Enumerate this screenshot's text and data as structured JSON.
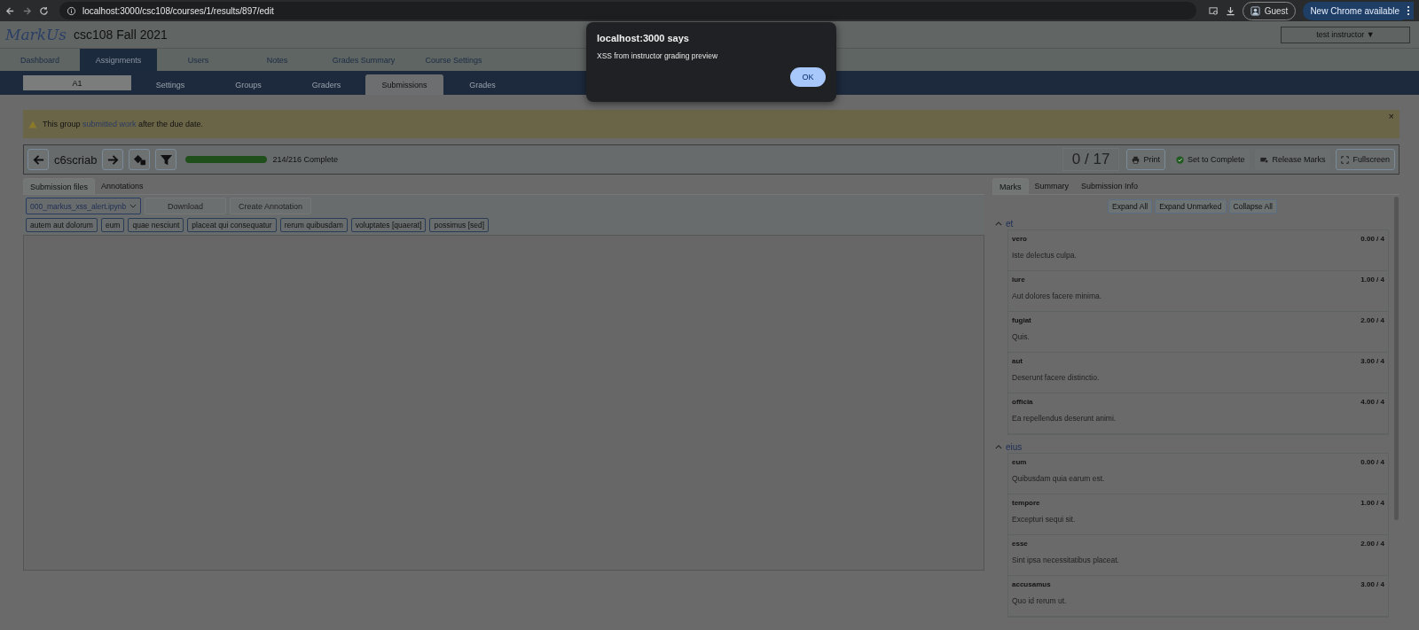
{
  "browser": {
    "url": "localhost:3000/csc108/courses/1/results/897/edit",
    "profile": "Guest",
    "update": "New Chrome available"
  },
  "dialog": {
    "title": "localhost:3000 says",
    "message": "XSS from instructor grading preview",
    "ok": "OK"
  },
  "header": {
    "logo": "MarkUs",
    "course": "csc108 Fall 2021",
    "user_menu": "test instructor ▼"
  },
  "nav_tabs": [
    {
      "label": "Dashboard",
      "selected": false
    },
    {
      "label": "Assignments",
      "selected": true
    },
    {
      "label": "Users",
      "selected": false
    },
    {
      "label": "Notes",
      "selected": false
    },
    {
      "label": "Grades Summary",
      "selected": false
    },
    {
      "label": "Course Settings",
      "selected": false
    }
  ],
  "sub_nav": {
    "assignment_select": "A1",
    "tabs": [
      {
        "label": "Settings",
        "selected": false
      },
      {
        "label": "Groups",
        "selected": false
      },
      {
        "label": "Graders",
        "selected": false
      },
      {
        "label": "Submissions",
        "selected": true
      },
      {
        "label": "Grades",
        "selected": false
      }
    ]
  },
  "notice": {
    "text_before": "This group",
    "link": "submitted work",
    "text_after": "after the due date.",
    "close": "×"
  },
  "toolbar": {
    "group_name": "c6scriab",
    "progress": {
      "level": 0.9907,
      "label": "214/216 Complete"
    },
    "total": "0 / 17",
    "buttons": [
      {
        "kind": "print",
        "label": "Print"
      },
      {
        "kind": "complete",
        "label": "Set to Complete"
      },
      {
        "kind": "release",
        "label": "Release Marks"
      },
      {
        "kind": "fullscreen",
        "label": "Fullscreen"
      }
    ]
  },
  "left_panel": {
    "tabs": [
      {
        "label": "Submission files",
        "selected": true
      },
      {
        "label": "Annotations",
        "selected": false
      }
    ],
    "file_select": "000_markus_xss_alert.ipynb",
    "buttons": [
      "Download",
      "Create Annotation"
    ],
    "categories": [
      "autem aut dolorum",
      "eum",
      "quae nesciunt",
      "placeat qui consequatur",
      "rerum quibusdam",
      "voluptates [quaerat]",
      "possimus [sed]"
    ]
  },
  "right_panel": {
    "tabs": [
      {
        "label": "Marks",
        "selected": true
      },
      {
        "label": "Summary",
        "selected": false
      },
      {
        "label": "Submission Info",
        "selected": false
      }
    ],
    "buttons": [
      "Expand All",
      "Expand Unmarked",
      "Collapse All"
    ],
    "groups": [
      {
        "name": "et",
        "expanded": true,
        "criteria": [
          {
            "name": "vero",
            "score": "0.00 / 4",
            "description": "Iste delectus culpa."
          },
          {
            "name": "iure",
            "score": "1.00 / 4",
            "description": "Aut dolores facere minima."
          },
          {
            "name": "fugiat",
            "score": "2.00 / 4",
            "description": "Quis."
          },
          {
            "name": "aut",
            "score": "3.00 / 4",
            "description": "Deserunt facere distinctio."
          },
          {
            "name": "officia",
            "score": "4.00 / 4",
            "description": "Ea repellendus deserunt animi."
          }
        ]
      },
      {
        "name": "eius",
        "expanded": true,
        "criteria": [
          {
            "name": "eum",
            "score": "0.00 / 4",
            "description": "Quibusdam quia earum est."
          },
          {
            "name": "tempore",
            "score": "1.00 / 4",
            "description": "Excepturi sequi sit."
          },
          {
            "name": "esse",
            "score": "2.00 / 4",
            "description": "Sint ipsa necessitatibus placeat."
          },
          {
            "name": "accusamus",
            "score": "3.00 / 4",
            "description": "Quo id rerum ut."
          }
        ]
      }
    ]
  }
}
